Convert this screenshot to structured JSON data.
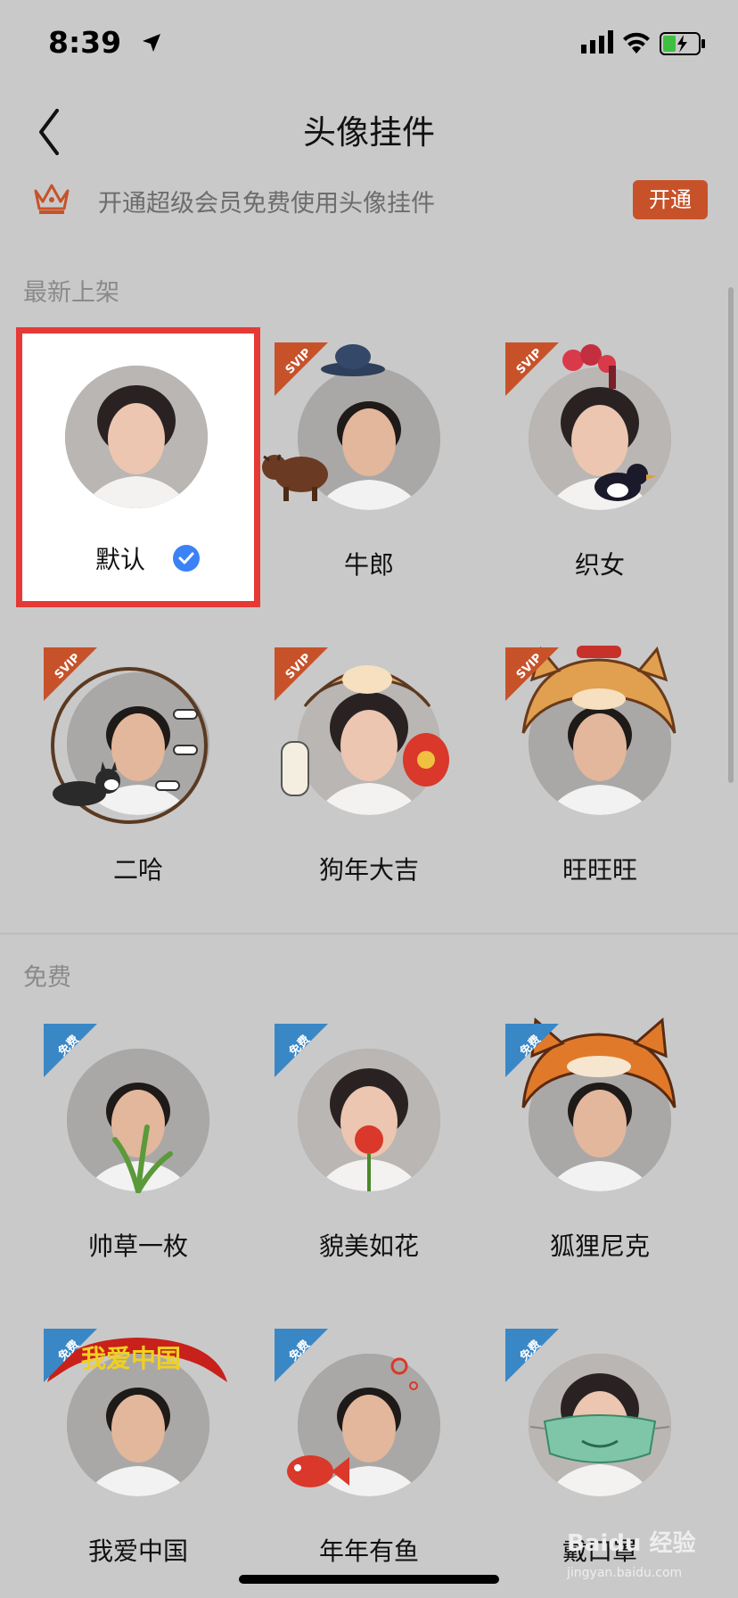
{
  "status_bar": {
    "time": "8:39"
  },
  "header": {
    "title": "头像挂件"
  },
  "promo": {
    "text": "开通超级会员免费使用头像挂件",
    "button_label": "开通"
  },
  "sections": {
    "new_title": "最新上架",
    "free_title": "免费"
  },
  "badges": {
    "svip": "SVIP",
    "free": "免费"
  },
  "new_items": [
    {
      "label": "默认",
      "selected": true
    },
    {
      "label": "牛郎",
      "badge": "SVIP"
    },
    {
      "label": "织女",
      "badge": "SVIP"
    },
    {
      "label": "二哈",
      "badge": "SVIP"
    },
    {
      "label": "狗年大吉",
      "badge": "SVIP"
    },
    {
      "label": "旺旺旺",
      "badge": "SVIP"
    }
  ],
  "free_items": [
    {
      "label": "帅草一枚",
      "badge": "免费"
    },
    {
      "label": "貌美如花",
      "badge": "免费"
    },
    {
      "label": "狐狸尼克",
      "badge": "免费"
    },
    {
      "label": "我爱中国",
      "badge": "免费",
      "banner_text": "我爱中国"
    },
    {
      "label": "年年有鱼",
      "badge": "免费"
    },
    {
      "label": "戴口罩",
      "badge": "免费"
    }
  ],
  "watermark": {
    "brand": "Baidu 经验",
    "url": "jingyan.baidu.com"
  },
  "colors": {
    "accent": "#c7522a",
    "free_badge": "#3a87c6",
    "check": "#3b82f6",
    "selected_outline": "#e53935"
  }
}
